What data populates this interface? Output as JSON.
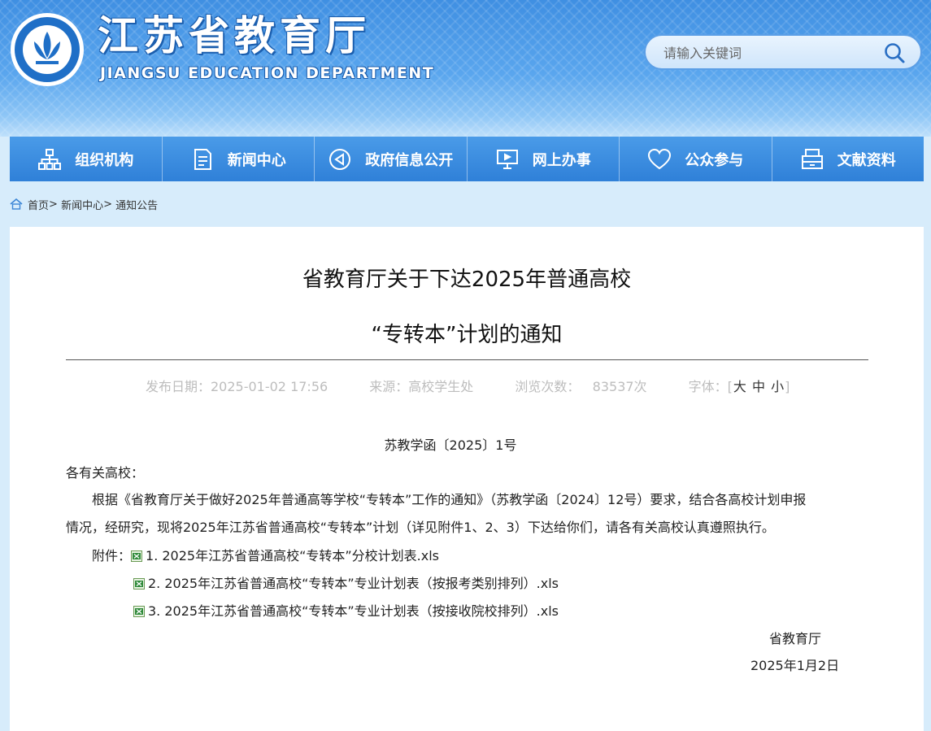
{
  "header": {
    "title": "江苏省教育厅",
    "subtitle": "JIANGSU EDUCATION DEPARTMENT",
    "search_placeholder": "请输入关键词"
  },
  "nav": [
    {
      "label": "组织机构",
      "icon": "org-chart-icon"
    },
    {
      "label": "新闻中心",
      "icon": "document-icon"
    },
    {
      "label": "政府信息公开",
      "icon": "info-open-icon"
    },
    {
      "label": "网上办事",
      "icon": "monitor-icon"
    },
    {
      "label": "公众参与",
      "icon": "heart-icon"
    },
    {
      "label": "文献资料",
      "icon": "archive-icon"
    }
  ],
  "breadcrumb": {
    "home": "首页",
    "sep": ">",
    "news": "新闻中心",
    "current": "通知公告"
  },
  "article": {
    "title_line1": "省教育厅关于下达2025年普通高校",
    "title_line2": "“专转本”计划的通知",
    "meta_date": "发布日期：2025-01-02 17:56",
    "meta_source": "来源：高校学生处",
    "meta_views": "浏览次数：   83537次",
    "font_label": "字体：[",
    "font_large": "大",
    "font_medium": "中",
    "font_small": "小",
    "font_close": "]",
    "doc_number": "苏教学函〔2025〕1号",
    "salutation": "各有关高校：",
    "para1_line1": "根据《省教育厅关于做好2025年普通高等学校“专转本”工作的通知》（苏教学函〔2024〕12号）要求，结合各高校计划申报",
    "para1_line2": "情况，经研究，现将2025年江苏省普通高校“专转本”计划（详见附件1、2、3）下达给你们，请各有关高校认真遵照执行。",
    "attachments_label": "附件：",
    "attachments": [
      "1. 2025年江苏省普通高校“专转本”分校计划表.xls",
      "2. 2025年江苏省普通高校“专转本”专业计划表（按报考类别排列）.xls",
      "3. 2025年江苏省普通高校“专转本”专业计划表（按接收院校排列）.xls"
    ],
    "signature": "省教育厅",
    "sign_date": "2025年1月2日"
  },
  "colors": {
    "nav_bg": "#2f80d8",
    "page_bg": "#d7ecfb"
  }
}
